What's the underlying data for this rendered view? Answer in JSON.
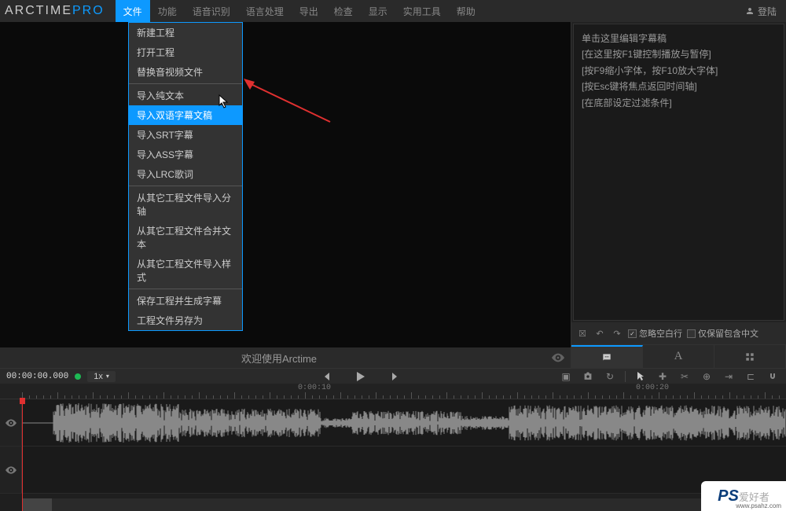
{
  "logo": {
    "brand": "ARCTIME",
    "suffix": "PRO"
  },
  "menubar": {
    "items": [
      "文件",
      "功能",
      "语音识别",
      "语言处理",
      "导出",
      "检查",
      "显示",
      "实用工具",
      "帮助"
    ],
    "active_index": 0,
    "login_label": "登陆"
  },
  "dropdown": {
    "groups": [
      [
        "新建工程",
        "打开工程",
        "替换音视频文件"
      ],
      [
        "导入纯文本",
        "导入双语字幕文稿",
        "导入SRT字幕",
        "导入ASS字幕",
        "导入LRC歌词"
      ],
      [
        "从其它工程文件导入分轴",
        "从其它工程文件合并文本",
        "从其它工程文件导入样式"
      ],
      [
        "保存工程并生成字幕",
        "工程文件另存为"
      ]
    ],
    "highlighted": "导入双语字幕文稿"
  },
  "preview": {
    "welcome": "欢迎使用Arctime"
  },
  "sidepanel": {
    "hints": [
      "单击这里编辑字幕稿",
      "[在这里按F1键控制播放与暂停]",
      "[按F9缩小字体，按F10放大字体]",
      "[按Esc键将焦点返回时间轴]",
      "[在底部设定过滤条件]"
    ],
    "checkbox1_label": "忽略空白行",
    "checkbox2_label": "仅保留包含中文"
  },
  "transport": {
    "timecode": "00:00:00.000",
    "speed": "1x"
  },
  "ruler": {
    "labels": [
      "0:00:10",
      "0:00:20"
    ]
  },
  "watermark": {
    "ps": "PS",
    "txt": "爱好者",
    "url": "www.psahz.com"
  }
}
